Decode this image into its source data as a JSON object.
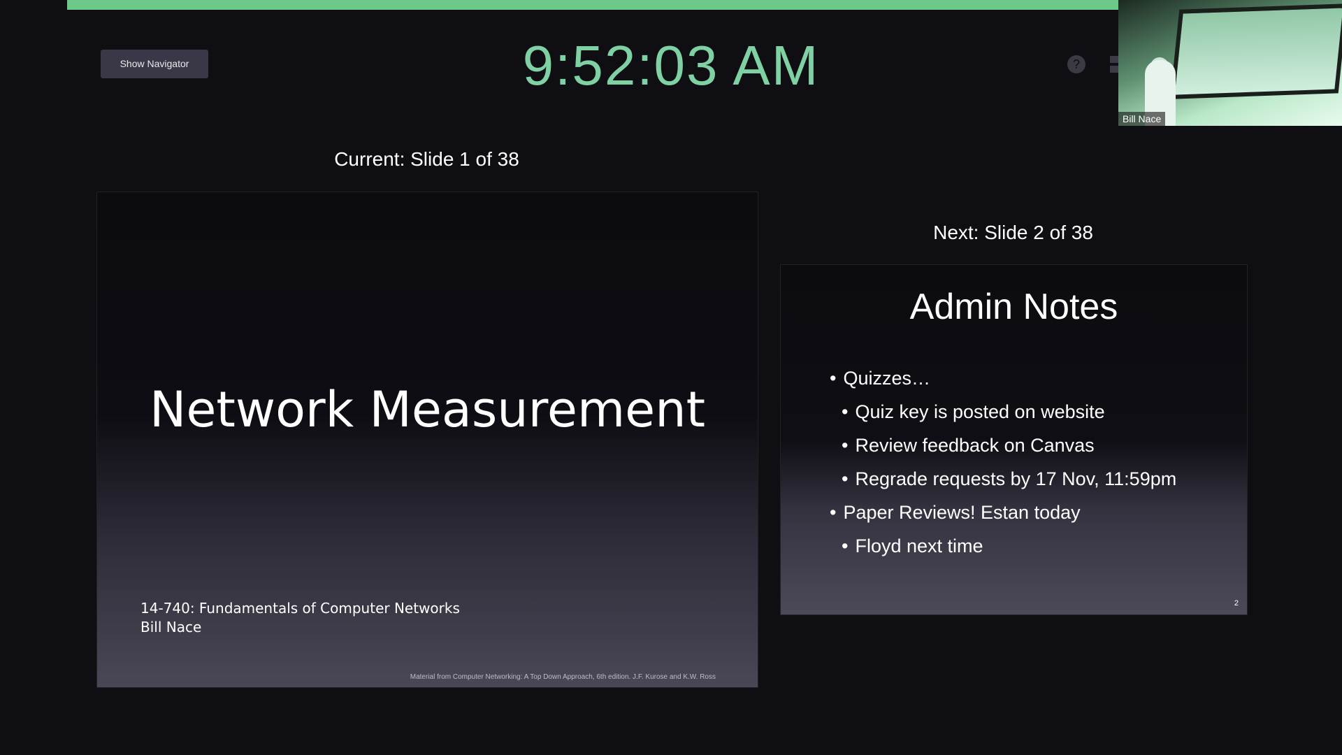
{
  "toolbar": {
    "show_navigator_label": "Show Navigator",
    "clock": "9:52:03 AM",
    "help_icon": "question-circle-icon",
    "layout_icon": "layout-toggle-icon"
  },
  "webcam": {
    "name": "Bill Nace"
  },
  "current": {
    "label": "Current: Slide 1 of 38",
    "title": "Network Measurement",
    "subtitle_line1": "14-740: Fundamentals of Computer Networks",
    "subtitle_line2": "Bill Nace",
    "credit": "Material from Computer Networking: A Top Down Approach, 6th edition. J.F. Kurose and K.W. Ross"
  },
  "next": {
    "label": "Next: Slide 2 of 38",
    "title": "Admin Notes",
    "bullets": [
      {
        "text": "Quizzes…",
        "level": 1
      },
      {
        "text": "Quiz key is posted on website",
        "level": 2
      },
      {
        "text": "Review feedback on Canvas",
        "level": 2
      },
      {
        "text": "Regrade requests by 17 Nov, 11:59pm",
        "level": 2
      },
      {
        "text": "Paper Reviews! Estan today",
        "level": 1
      },
      {
        "text": "Floyd next time",
        "level": 2
      }
    ],
    "page_number": "2"
  },
  "colors": {
    "background": "#0e0e13",
    "accent_bar": "#6cc98a",
    "clock": "#7fd1a4"
  }
}
